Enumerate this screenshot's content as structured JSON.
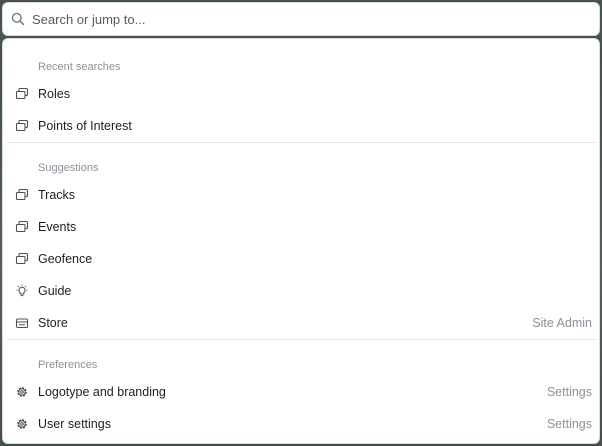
{
  "search": {
    "placeholder": "Search or jump to..."
  },
  "sections": {
    "recent": {
      "title": "Recent searches",
      "items": [
        {
          "label": "Roles",
          "icon": "window-stack-icon"
        },
        {
          "label": "Points of Interest",
          "icon": "window-stack-icon"
        }
      ]
    },
    "suggestions": {
      "title": "Suggestions",
      "items": [
        {
          "label": "Tracks",
          "icon": "window-stack-icon"
        },
        {
          "label": "Events",
          "icon": "window-stack-icon"
        },
        {
          "label": "Geofence",
          "icon": "window-stack-icon"
        },
        {
          "label": "Guide",
          "icon": "lightbulb-icon"
        },
        {
          "label": "Store",
          "icon": "store-icon",
          "hint": "Site Admin"
        }
      ]
    },
    "preferences": {
      "title": "Preferences",
      "items": [
        {
          "label": "Logotype and branding",
          "icon": "gear-icon",
          "hint": "Settings"
        },
        {
          "label": "User settings",
          "icon": "gear-icon",
          "hint": "Settings"
        }
      ]
    }
  },
  "colors": {
    "text": "#1b1f24",
    "muted": "#8a9199",
    "border": "#d7dbe0"
  }
}
